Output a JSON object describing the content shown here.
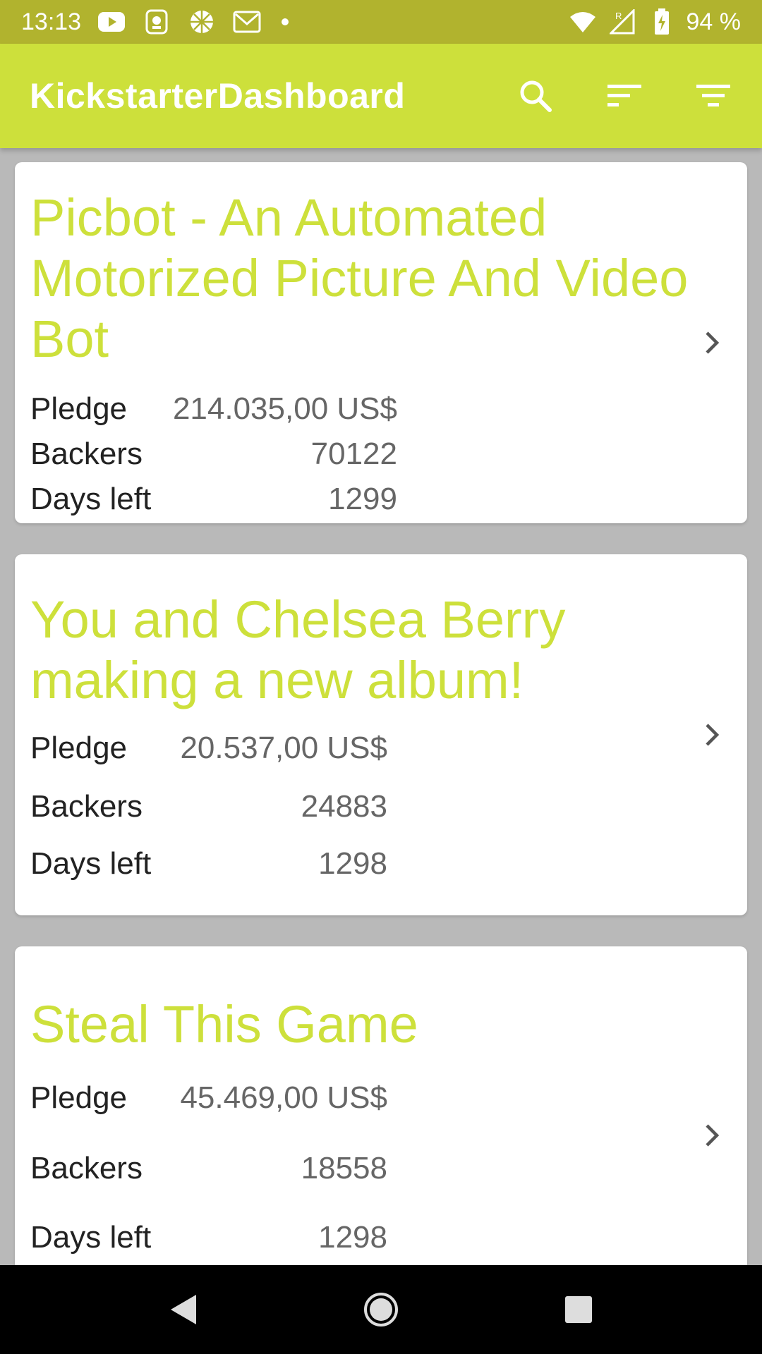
{
  "status_bar": {
    "time": "13:13",
    "battery": "94 %",
    "notification_icons": [
      "youtube-icon",
      "lion-app-icon",
      "ball-app-icon",
      "gmail-icon"
    ],
    "signal_roaming": "R"
  },
  "app_bar": {
    "title": "KickstarterDashboard",
    "actions": [
      "search-icon",
      "sort-icon",
      "filter-icon"
    ]
  },
  "labels": {
    "pledge": "Pledge",
    "backers": "Backers",
    "days_left": "Days left"
  },
  "projects": [
    {
      "title": "Picbot - An Automated Motorized Picture And Video Bot",
      "pledge": "214.035,00 US$",
      "backers": "70122",
      "days_left": "1299"
    },
    {
      "title": "You and Chelsea Berry making a new album!",
      "pledge": "20.537,00 US$",
      "backers": "24883",
      "days_left": "1298"
    },
    {
      "title": "Steal This Game",
      "pledge": "45.469,00 US$",
      "backers": "18558",
      "days_left": "1298"
    }
  ],
  "colors": {
    "status_bar": "#b1b32e",
    "app_bar": "#cde03b",
    "accent_title": "#cde03b",
    "background": "#b9b9b9"
  }
}
